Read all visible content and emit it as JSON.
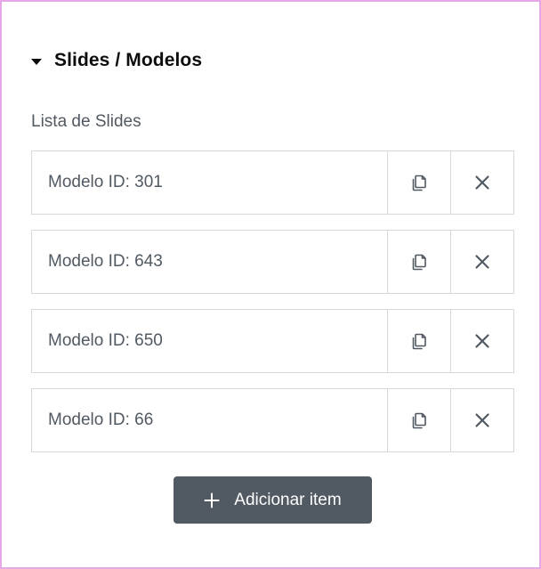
{
  "section": {
    "title": "Slides / Modelos",
    "collapse_icon": "caret-down-icon"
  },
  "list": {
    "label": "Lista de Slides",
    "items": [
      {
        "title": "Modelo ID: 301"
      },
      {
        "title": "Modelo ID: 643"
      },
      {
        "title": "Modelo ID: 650"
      },
      {
        "title": "Modelo ID: 66"
      }
    ],
    "duplicate_icon": "duplicate-icon",
    "remove_icon": "close-icon"
  },
  "add_button": {
    "label": "Adicionar item",
    "icon": "plus-icon"
  },
  "colors": {
    "frame_border": "#e6a8e6",
    "text": "#515962",
    "heading": "#0c0d0e",
    "row_border": "#d5d8dc",
    "button_bg": "#515962",
    "button_text": "#ffffff"
  }
}
